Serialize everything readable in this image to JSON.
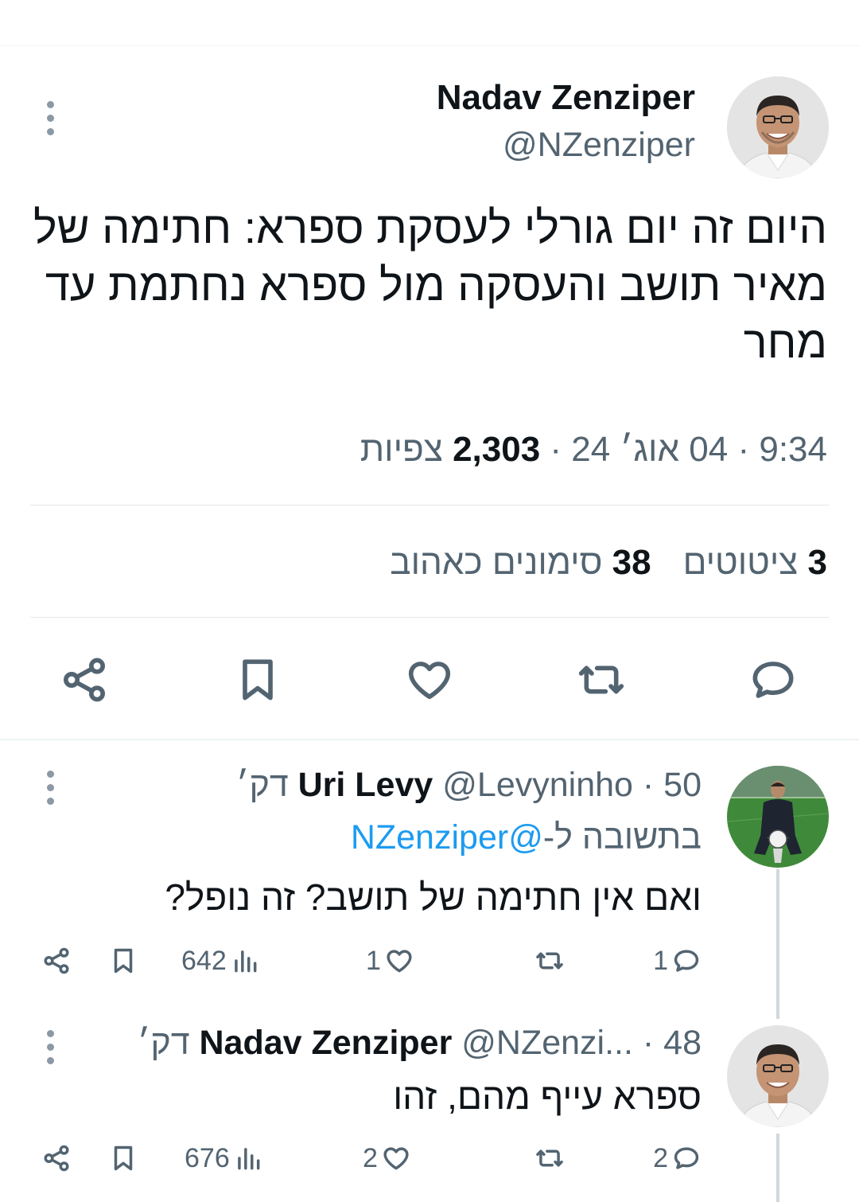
{
  "main_tweet": {
    "name": "Nadav Zenziper",
    "handle": "@NZenziper",
    "text": "היום זה יום גורלי לעסקת ספרא: חתימה של מאיר תושב והעסקה מול ספרא נחתמת עד מחר",
    "meta_time": "9:34 · 04 אוג׳ 24 · ",
    "views_count": "2,303",
    "views_label": " צפיות",
    "quotes_count": "3",
    "quotes_label": " ציטוטים",
    "likes_count": "38",
    "likes_label": " סימונים כאהוב",
    "icons": [
      "reply-icon",
      "retweet-icon",
      "like-icon",
      "bookmark-icon",
      "share-icon"
    ]
  },
  "replies": [
    {
      "name": "Uri Levy",
      "handle_time": " @Levyninho · 50 דק׳",
      "reply_to_prefix": "בתשובה ל-",
      "reply_to_handle": "@NZenziper",
      "text": "ואם אין חתימה של תושב? זה נופל?",
      "reply_count": "1",
      "retweet_count": "",
      "like_count": "1",
      "views": "642"
    },
    {
      "name": "Nadav Zenziper",
      "handle_time": " @NZenzi... · 48 דק׳",
      "text": "ספרא עייף מהם, זהו",
      "reply_count": "2",
      "retweet_count": "",
      "like_count": "2",
      "views": "676"
    }
  ],
  "colors": {
    "text_primary": "#0f1419",
    "text_secondary": "#536471",
    "link": "#1d9bf0",
    "divider": "#eff3f4"
  }
}
